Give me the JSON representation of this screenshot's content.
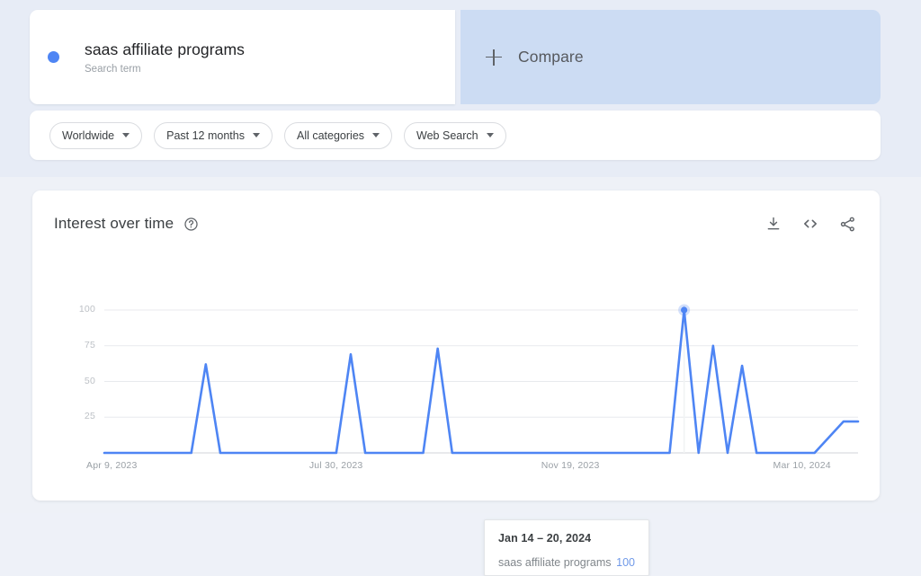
{
  "search_term": {
    "title": "saas affiliate programs",
    "subtitle": "Search term",
    "dot_color": "#4e85f4"
  },
  "compare": {
    "label": "Compare",
    "icon": "plus-icon"
  },
  "filters": [
    {
      "label": "Worldwide"
    },
    {
      "label": "Past 12 months"
    },
    {
      "label": "All categories"
    },
    {
      "label": "Web Search"
    }
  ],
  "chart_card": {
    "title": "Interest over time",
    "help_icon": "help-circle-icon",
    "actions": [
      {
        "name": "download-icon"
      },
      {
        "name": "embed-code-icon"
      },
      {
        "name": "share-icon"
      }
    ]
  },
  "tooltip": {
    "date": "Jan 14 – 20, 2024",
    "series_name": "saas affiliate programs",
    "value": "100",
    "value_color": "#7099e8"
  },
  "chart_data": {
    "type": "line",
    "title": "Interest over time",
    "xlabel": "",
    "ylabel": "",
    "ylim": [
      0,
      100
    ],
    "yticks": [
      25,
      50,
      75,
      100
    ],
    "ytick_labels": [
      "25",
      "50",
      "75",
      "100"
    ],
    "xtick_labels": [
      "Apr 9, 2023",
      "Jul 30, 2023",
      "Nov 19, 2023",
      "Mar 10, 2024"
    ],
    "xtick_positions": [
      0,
      16,
      32,
      48
    ],
    "grid": true,
    "legend": "none",
    "line_color": "#4e85f4",
    "line_width": 2.6,
    "highlight_index": 40,
    "highlight_value": 100,
    "series": [
      {
        "name": "saas affiliate programs",
        "values": [
          0,
          0,
          0,
          0,
          0,
          0,
          0,
          62,
          0,
          0,
          0,
          0,
          0,
          0,
          0,
          0,
          0,
          69,
          0,
          0,
          0,
          0,
          0,
          73,
          0,
          0,
          0,
          0,
          0,
          0,
          0,
          0,
          0,
          0,
          0,
          0,
          0,
          0,
          0,
          0,
          100,
          0,
          75,
          0,
          61,
          0,
          0,
          0,
          0,
          0,
          11,
          22,
          22
        ]
      }
    ]
  }
}
